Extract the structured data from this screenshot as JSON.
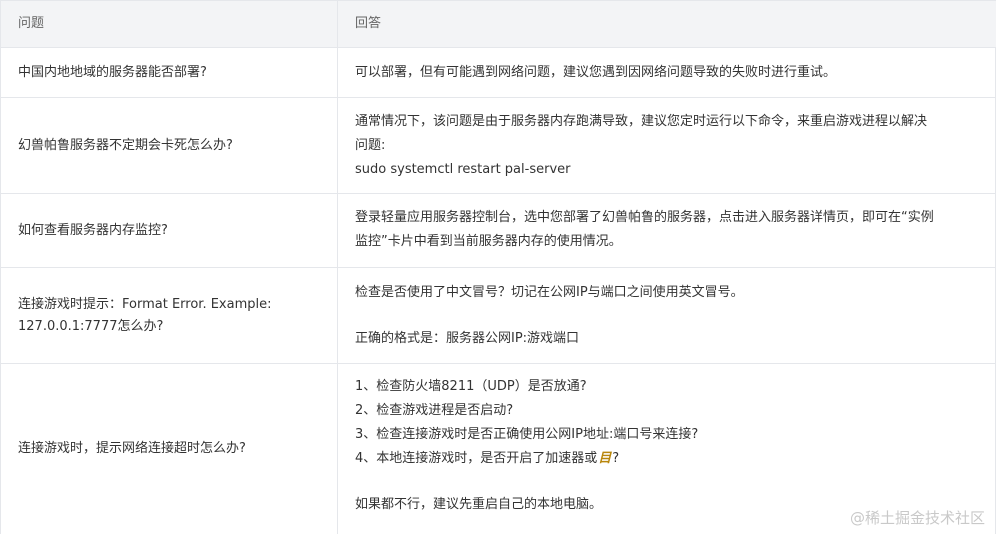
{
  "header": {
    "question_col": "问题",
    "answer_col": "回答"
  },
  "rows": [
    {
      "question": "中国内地地域的服务器能否部署?",
      "answer_lines": [
        "可以部署，但有可能遇到网络问题，建议您遇到因网络问题导致的失败时进行重试。"
      ]
    },
    {
      "question": "幻兽帕鲁服务器不定期会卡死怎么办?",
      "answer_lines": [
        "通常情况下，该问题是由于服务器内存跑满导致，建议您定时运行以下命令，来重启游戏进程以解决",
        "问题:",
        "sudo systemctl restart pal-server"
      ]
    },
    {
      "question": "如何查看服务器内存监控?",
      "answer_lines": [
        "登录轻量应用服务器控制台，选中您部署了幻兽帕鲁的服务器，点击进入服务器详情页，即可在“实例",
        "监控”卡片中看到当前服务器内存的使用情况。"
      ]
    },
    {
      "question_lines": [
        "连接游戏时提示：Format Error. Example:",
        "127.0.0.1:7777怎么办?"
      ],
      "answer_lines": [
        "检查是否使用了中文冒号？切记在公网IP与端口之间使用英文冒号。",
        "",
        "正确的格式是：服务器公网IP:游戏端口"
      ]
    },
    {
      "question": "连接游戏时，提示网络连接超时怎么办?",
      "answer_lines": [
        "1、检查防火墙8211（UDP）是否放通?",
        "2、检查游戏进程是否启动?",
        "3、检查连接游戏时是否正确使用公网IP地址:端口号来连接?",
        "4、本地连接游戏时，是否开启了加速器或",
        "",
        "如果都不行，建议先重启自己的本地电脑。"
      ],
      "inline_mark": "目",
      "inline_mark_suffix": "?"
    }
  ],
  "watermark": "@稀土掘金技术社区"
}
